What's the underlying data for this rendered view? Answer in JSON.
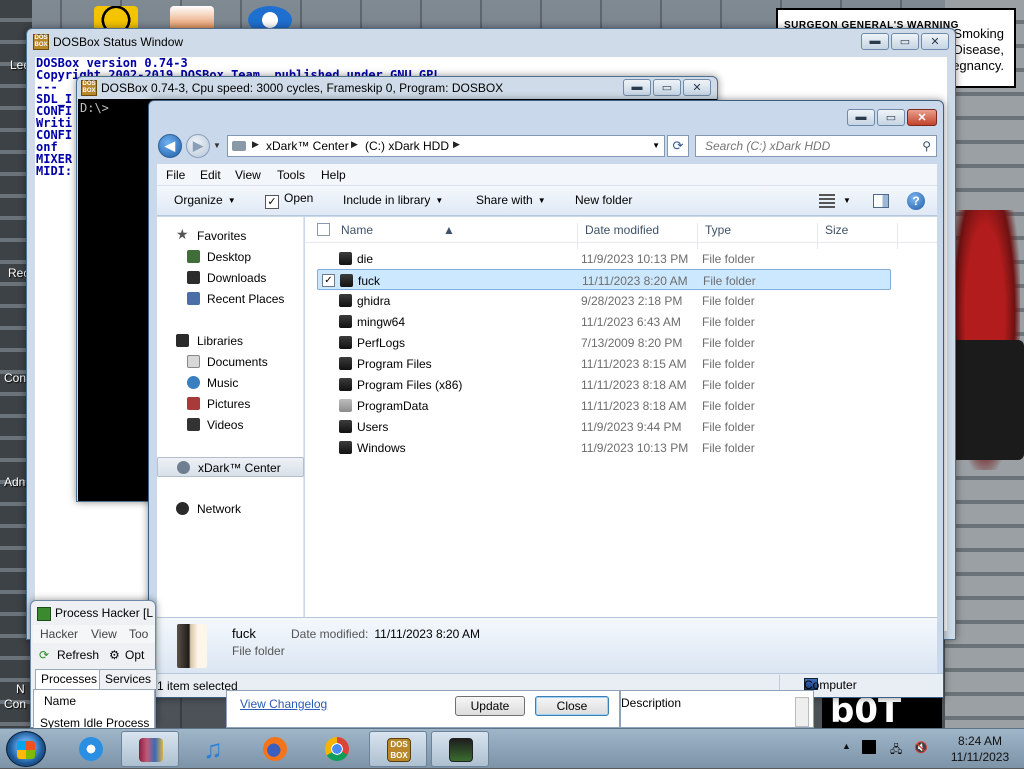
{
  "desktop": {
    "left_labels": [
      "Lee",
      "Rec",
      "Con",
      "Adn",
      "N",
      "Con"
    ],
    "warning": {
      "heading": "SURGEON GENERAL'S WARNING",
      "lines": [
        "Smoking",
        "Disease,",
        "regnancy."
      ]
    },
    "bot_text": "b0T"
  },
  "dos_status": {
    "title": "DOSBox Status Window",
    "lines": [
      "DOSBox version 0.74-3",
      "Copyright 2002-2019 DOSBox Team, published under GNU GPL.",
      "---",
      "SDL_I",
      "",
      "CONFI",
      "Writi",
      "CONFI",
      "onf",
      "MIXER",
      "MIDI:"
    ]
  },
  "dosbox": {
    "title": "DOSBox 0.74-3, Cpu speed:    3000 cycles, Frameskip  0, Program:  DOSBOX",
    "prompt": "D:\\>"
  },
  "explorer": {
    "address": {
      "crumbs": [
        "xDark™ Center",
        "(C:) xDark HDD"
      ]
    },
    "search": {
      "placeholder": "Search (C:) xDark HDD"
    },
    "menu": [
      "File",
      "Edit",
      "View",
      "Tools",
      "Help"
    ],
    "toolbar": {
      "organize": "Organize",
      "open": "Open",
      "include": "Include in library",
      "share": "Share with",
      "new_folder": "New folder"
    },
    "nav": {
      "favorites": "Favorites",
      "favorites_items": [
        "Desktop",
        "Downloads",
        "Recent Places"
      ],
      "libraries": "Libraries",
      "libraries_items": [
        "Documents",
        "Music",
        "Pictures",
        "Videos"
      ],
      "homegroup": "xDark™ Center",
      "network": "Network"
    },
    "columns": [
      "Name",
      "Date modified",
      "Type",
      "Size"
    ],
    "files": [
      {
        "name": "die",
        "date": "11/9/2023 10:13 PM",
        "type": "File folder"
      },
      {
        "name": "fuck",
        "date": "11/11/2023 8:20 AM",
        "type": "File folder"
      },
      {
        "name": "ghidra",
        "date": "9/28/2023 2:18 PM",
        "type": "File folder"
      },
      {
        "name": "mingw64",
        "date": "11/1/2023 6:43 AM",
        "type": "File folder"
      },
      {
        "name": "PerfLogs",
        "date": "7/13/2009 8:20 PM",
        "type": "File folder"
      },
      {
        "name": "Program Files",
        "date": "11/11/2023 8:15 AM",
        "type": "File folder"
      },
      {
        "name": "Program Files (x86)",
        "date": "11/11/2023 8:18 AM",
        "type": "File folder"
      },
      {
        "name": "ProgramData",
        "date": "11/11/2023 8:18 AM",
        "type": "File folder"
      },
      {
        "name": "Users",
        "date": "11/9/2023 9:44 PM",
        "type": "File folder"
      },
      {
        "name": "Windows",
        "date": "11/9/2023 10:13 PM",
        "type": "File folder"
      }
    ],
    "selected_index": 1,
    "details": {
      "name": "fuck",
      "type": "File folder",
      "date_label": "Date modified:",
      "date_value": "11/11/2023 8:20 AM"
    },
    "status": {
      "selected": "1 item selected",
      "computer": "Computer"
    }
  },
  "process_hacker": {
    "title": "Process Hacker [L",
    "menu": [
      "Hacker",
      "View",
      "Too"
    ],
    "refresh": "Refresh",
    "options": "Opt",
    "tabs": [
      "Processes",
      "Services"
    ],
    "col_name": "Name",
    "row": "System Idle Process"
  },
  "update_dialog": {
    "changelog": "View Changelog",
    "update": "Update",
    "close": "Close",
    "description": "Description"
  },
  "taskbar": {
    "time": "8:24 AM",
    "date": "11/11/2023",
    "apps": [
      "ie-icon",
      "winrar-icon",
      "music-icon",
      "firefox-icon",
      "chrome-icon",
      "dosbox-icon",
      "process-hacker-icon"
    ]
  },
  "colors": {
    "selection": "#cce8ff",
    "console_text": "#0000a8",
    "title_close": "#c2432b"
  }
}
